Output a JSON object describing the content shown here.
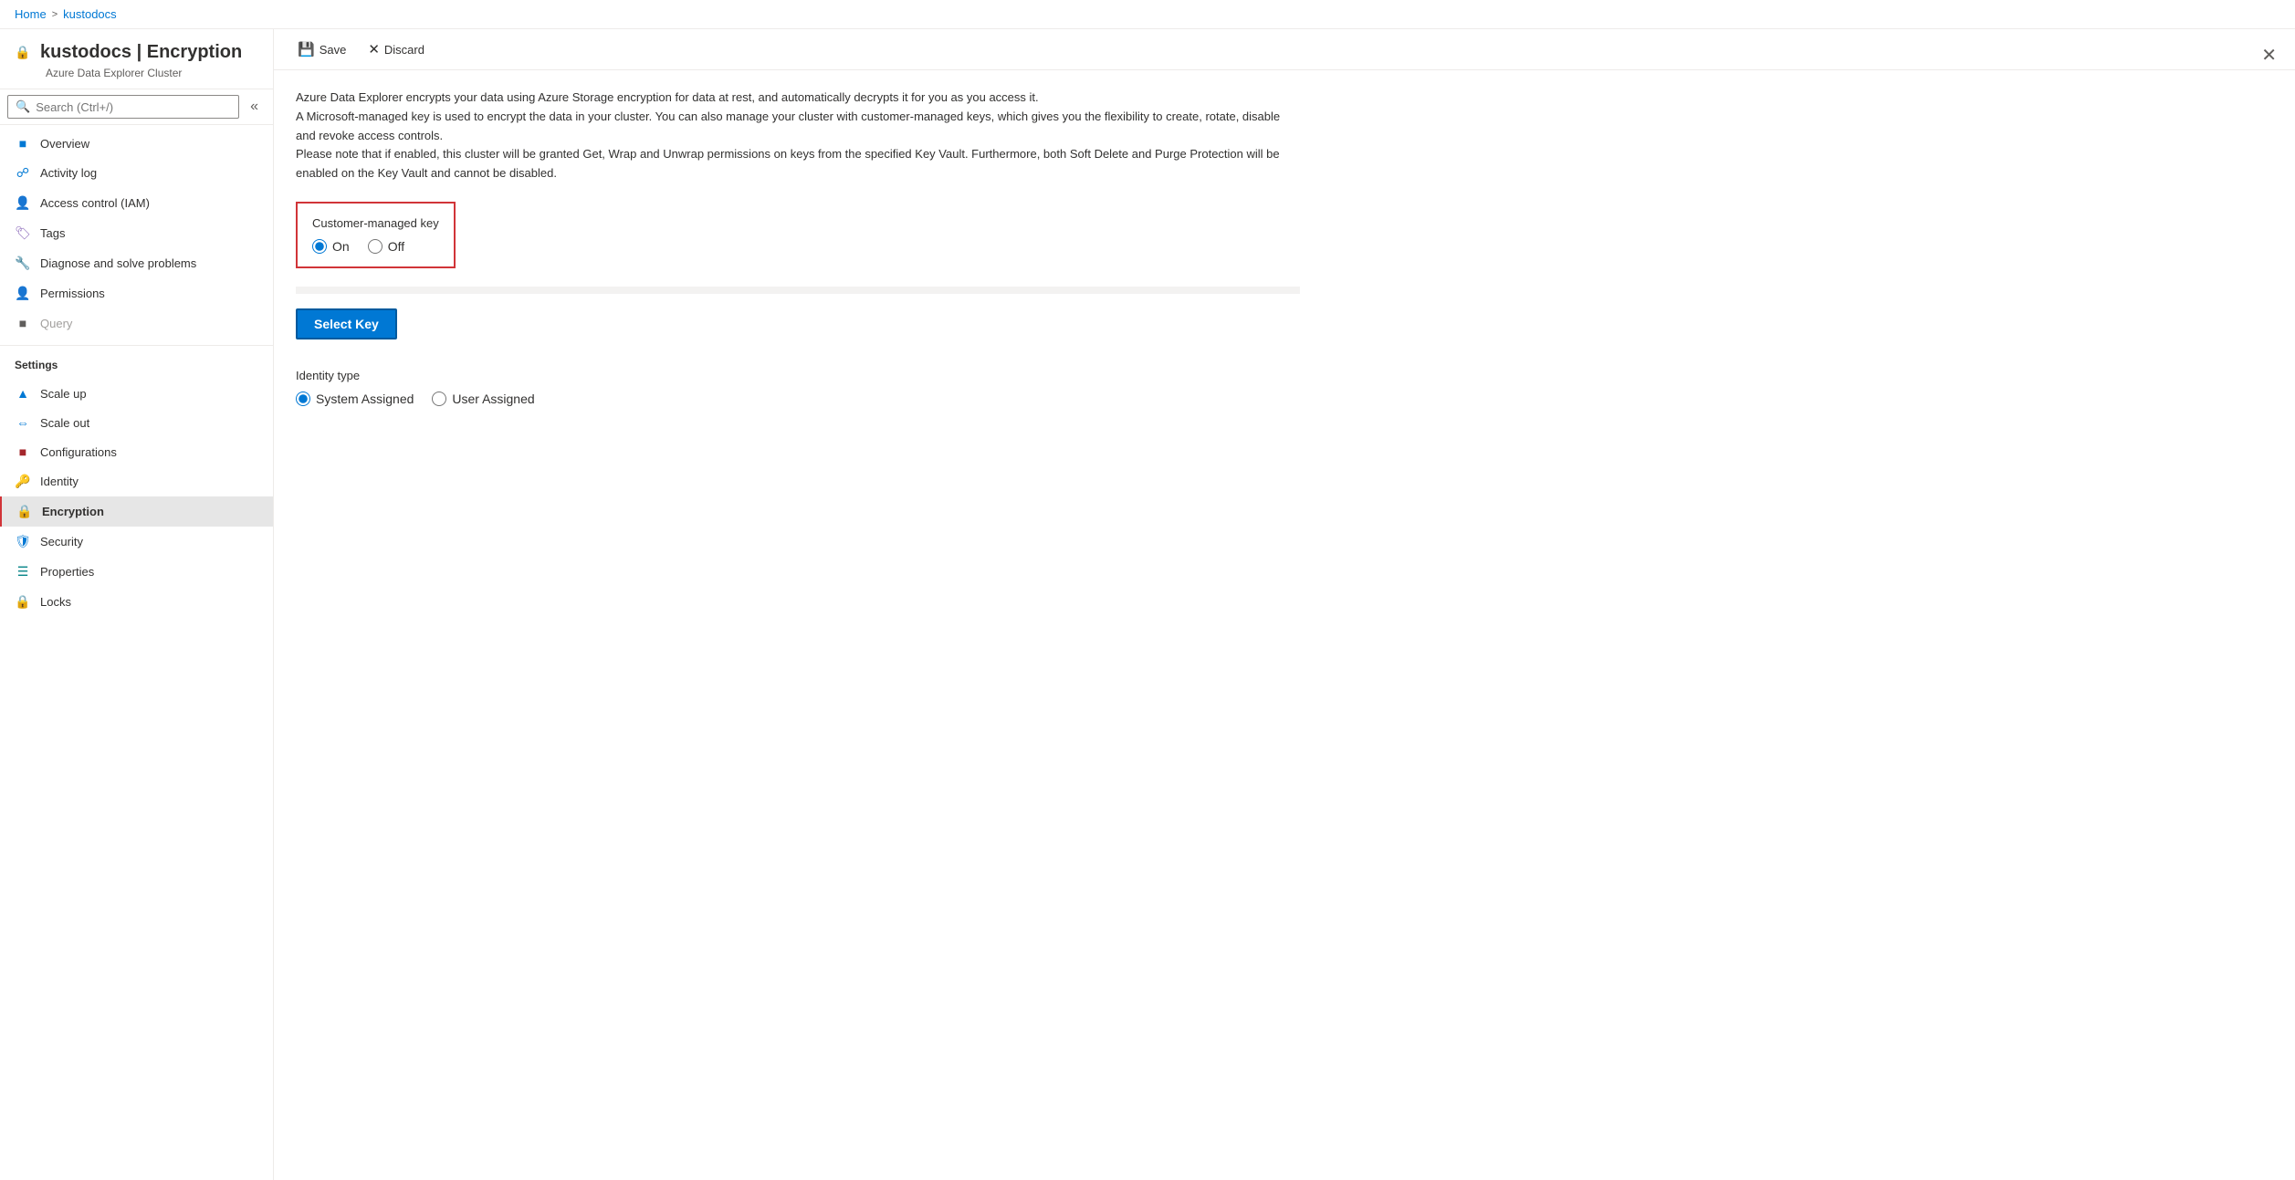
{
  "breadcrumb": {
    "home": "Home",
    "separator": ">",
    "cluster": "kustodocs"
  },
  "header": {
    "title": "kustodocs | Encryption",
    "subtitle": "Azure Data Explorer Cluster",
    "icon": "🔒"
  },
  "search": {
    "placeholder": "Search (Ctrl+/)"
  },
  "toolbar": {
    "save_label": "Save",
    "discard_label": "Discard"
  },
  "description": {
    "line1": "Azure Data Explorer encrypts your data using Azure Storage encryption for data at rest, and automatically decrypts it for you as you access it.",
    "line2": "A Microsoft-managed key is used to encrypt the data in your cluster. You can also manage your cluster with customer-managed keys, which gives you the flexibility to create, rotate, disable and revoke access controls.",
    "line3": "Please note that if enabled, this cluster will be granted Get, Wrap and Unwrap permissions on keys from the specified Key Vault. Furthermore, both Soft Delete and Purge Protection will be enabled on the Key Vault and cannot be disabled."
  },
  "customer_managed_key": {
    "label": "Customer-managed key",
    "on_label": "On",
    "off_label": "Off",
    "selected": "on"
  },
  "select_key_button": "Select Key",
  "identity_type": {
    "label": "Identity type",
    "system_assigned": "System Assigned",
    "user_assigned": "User Assigned",
    "selected": "system"
  },
  "nav": {
    "overview": "Overview",
    "activity_log": "Activity log",
    "access_control": "Access control (IAM)",
    "tags": "Tags",
    "diagnose": "Diagnose and solve problems",
    "permissions": "Permissions",
    "query": "Query",
    "settings_label": "Settings",
    "scale_up": "Scale up",
    "scale_out": "Scale out",
    "configurations": "Configurations",
    "identity": "Identity",
    "encryption": "Encryption",
    "security": "Security",
    "properties": "Properties",
    "locks": "Locks"
  }
}
